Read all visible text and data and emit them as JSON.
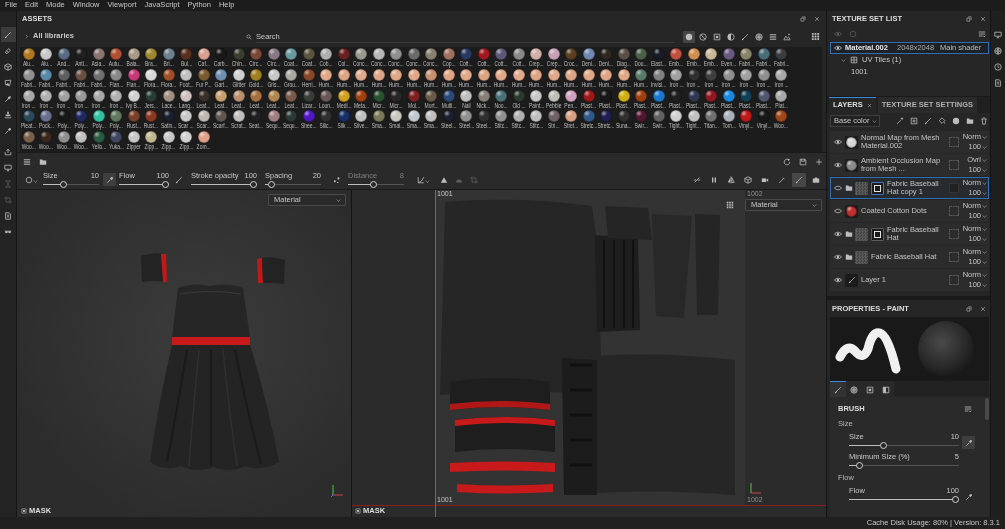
{
  "menu": [
    "File",
    "Edit",
    "Mode",
    "Window",
    "Viewport",
    "JavaScript",
    "Python",
    "Help"
  ],
  "tool_strip": {
    "tools": [
      {
        "selected": true
      },
      {
        "selected": false
      },
      {
        "selected": false
      },
      {
        "selected": false
      },
      {
        "selected": false
      },
      {
        "selected": false
      },
      {
        "selected": false
      }
    ],
    "actions": [
      {
        "disabled": false
      },
      {
        "disabled": false
      },
      {
        "disabled": true
      },
      {
        "disabled": true
      },
      {
        "disabled": false
      },
      {
        "disabled": false
      }
    ]
  },
  "assets": {
    "title": "ASSETS",
    "library": "All libraries",
    "search": {
      "placeholder": "Search"
    },
    "filters": [
      {
        "selected": true
      },
      {
        "selected": false
      },
      {
        "selected": false
      },
      {
        "selected": false
      },
      {
        "selected": false
      },
      {
        "selected": false
      },
      {
        "selected": false
      },
      {
        "selected": false
      }
    ],
    "items": [
      {
        "label": "Alu...",
        "color": "#b07820"
      },
      {
        "label": "Alu...",
        "color": "#c8c8c8"
      },
      {
        "label": "And...",
        "color": "#5a6a80"
      },
      {
        "label": "Antl...",
        "color": "#202020"
      },
      {
        "label": "Asia...",
        "color": "#8a7570"
      },
      {
        "label": "Autu...",
        "color": "#b05030"
      },
      {
        "label": "Bala...",
        "color": "#a89a88"
      },
      {
        "label": "Bra...",
        "color": "#a08830"
      },
      {
        "label": "Bri...",
        "color": "#708090"
      },
      {
        "label": "Bul...",
        "color": "#5a3020"
      },
      {
        "label": "Caf...",
        "color": "#d8a090"
      },
      {
        "label": "Carb...",
        "color": "#181818"
      },
      {
        "label": "Chin...",
        "color": "#3a4030"
      },
      {
        "label": "Circ...",
        "color": "#7a4838"
      },
      {
        "label": "Circ...",
        "color": "#8a7888"
      },
      {
        "label": "Coat...",
        "color": "#6a9aa0"
      },
      {
        "label": "Coat...",
        "color": "#5a5440"
      },
      {
        "label": "Cob...",
        "color": "#b0b0b0"
      },
      {
        "label": "Col...",
        "color": "#6a2020"
      },
      {
        "label": "Conc...",
        "color": "#9a9890"
      },
      {
        "label": "Conc...",
        "color": "#b8b8b8"
      },
      {
        "label": "Conc...",
        "color": "#909090"
      },
      {
        "label": "Conc...",
        "color": "#6a6a6a"
      },
      {
        "label": "Conc...",
        "color": "#8a8070"
      },
      {
        "label": "Cop...",
        "color": "#a07060"
      },
      {
        "label": "Cott...",
        "color": "#283860"
      },
      {
        "label": "Cott...",
        "color": "#a01820"
      },
      {
        "label": "Cott...",
        "color": "#605878"
      },
      {
        "label": "Cott...",
        "color": "#8a8a8a"
      },
      {
        "label": "Crep...",
        "color": "#d0b0a8"
      },
      {
        "label": "Crep...",
        "color": "#c8a0b8"
      },
      {
        "label": "Croc...",
        "color": "#5a4020"
      },
      {
        "label": "Deni...",
        "color": "#7088b0"
      },
      {
        "label": "Deni...",
        "color": "#302820"
      },
      {
        "label": "Diag...",
        "color": "#5a5048"
      },
      {
        "label": "Dou...",
        "color": "#4a6048"
      },
      {
        "label": "Elast...",
        "color": "#181c28"
      },
      {
        "label": "Emb...",
        "color": "#c05040"
      },
      {
        "label": "Emb...",
        "color": "#d09050"
      },
      {
        "label": "Emb...",
        "color": "#c8b898"
      },
      {
        "label": "Even...",
        "color": "#6a5880"
      },
      {
        "label": "Fabri...",
        "color": "#8a8468"
      },
      {
        "label": "Fabri...",
        "color": "#4a6a78"
      },
      {
        "label": "Fabri...",
        "color": "#3a3c40"
      },
      {
        "label": "Fabri...",
        "color": "#909090"
      },
      {
        "label": "Fabri...",
        "color": "#5a88a8"
      },
      {
        "label": "Fabri...",
        "color": "#606060"
      },
      {
        "label": "Fabri...",
        "color": "#6a5040"
      },
      {
        "label": "Fabri...",
        "color": "#707070"
      },
      {
        "label": "Flan...",
        "color": "#888888"
      },
      {
        "label": "Flan...",
        "color": "#c83878"
      },
      {
        "label": "Flora...",
        "color": "#d8d8d8"
      },
      {
        "label": "Flora...",
        "color": "#a05028"
      },
      {
        "label": "Foot...",
        "color": "#c0c0c0"
      },
      {
        "label": "Fur P...",
        "color": "#7a5a30"
      },
      {
        "label": "Gart...",
        "color": "#7090b0"
      },
      {
        "label": "Glitter",
        "color": "#d0d0d0"
      },
      {
        "label": "Gold...",
        "color": "#a08020"
      },
      {
        "label": "Gris...",
        "color": "#c8c8c8"
      },
      {
        "label": "Grou...",
        "color": "#a8a8a0"
      },
      {
        "label": "Herri...",
        "color": "#8a4828"
      },
      {
        "label": "Hum...",
        "color": "#e0a888"
      },
      {
        "label": "Hum...",
        "color": "#dca482"
      },
      {
        "label": "Hum...",
        "color": "#e2aa8c"
      },
      {
        "label": "Hum...",
        "color": "#dea686"
      },
      {
        "label": "Hum...",
        "color": "#e0a888"
      },
      {
        "label": "Hum...",
        "color": "#e0a888"
      },
      {
        "label": "Hum...",
        "color": "#c89070"
      },
      {
        "label": "Hum...",
        "color": "#dea686"
      },
      {
        "label": "Hum...",
        "color": "#e0a888"
      },
      {
        "label": "Hum...",
        "color": "#dca482"
      },
      {
        "label": "Hum...",
        "color": "#e0a888"
      },
      {
        "label": "Hum...",
        "color": "#e2aa8c"
      },
      {
        "label": "Hum...",
        "color": "#dea686"
      },
      {
        "label": "Hum...",
        "color": "#e0a888"
      },
      {
        "label": "Hum...",
        "color": "#dca482"
      },
      {
        "label": "Hum...",
        "color": "#e0a888"
      },
      {
        "label": "Hum...",
        "color": "#dea686"
      },
      {
        "label": "Hum...",
        "color": "#e0a888"
      },
      {
        "label": "Hum...",
        "color": "#5a7a68"
      },
      {
        "label": "Invisi...",
        "color": "#808080"
      },
      {
        "label": "Iron ...",
        "color": "#a0a0a0"
      },
      {
        "label": "Iron ...",
        "color": "#303030"
      },
      {
        "label": "Iron ...",
        "color": "#404040"
      },
      {
        "label": "Iron ...",
        "color": "#909090"
      },
      {
        "label": "Iron ...",
        "color": "#a0a0a0"
      },
      {
        "label": "Iron ...",
        "color": "#909090"
      },
      {
        "label": "Iron ...",
        "color": "#a8a8a8"
      },
      {
        "label": "Iron ...",
        "color": "#a8a8a8"
      },
      {
        "label": "Iron ...",
        "color": "#b0b0b0"
      },
      {
        "label": "Iron ...",
        "color": "#a0a0a0"
      },
      {
        "label": "Iron ...",
        "color": "#989898"
      },
      {
        "label": "Iron ...",
        "color": "#a8a8a8"
      },
      {
        "label": "Iron ...",
        "color": "#b0b0b0"
      },
      {
        "label": "Ivy B...",
        "color": "#d0d0d0"
      },
      {
        "label": "Jers...",
        "color": "#2a3c38"
      },
      {
        "label": "Lace...",
        "color": "#a09080"
      },
      {
        "label": "Lang...",
        "color": "#d0c0c0"
      },
      {
        "label": "Leat...",
        "color": "#3a3028"
      },
      {
        "label": "Leat...",
        "color": "#c8a070"
      },
      {
        "label": "Leat...",
        "color": "#b89070"
      },
      {
        "label": "Leat...",
        "color": "#a87040"
      },
      {
        "label": "Leat...",
        "color": "#b08850"
      },
      {
        "label": "Leat...",
        "color": "#7a5a48"
      },
      {
        "label": "Lizar...",
        "color": "#3a3e38"
      },
      {
        "label": "Loun...",
        "color": "#6a5858"
      },
      {
        "label": "Medi...",
        "color": "#d0a020"
      },
      {
        "label": "Meta...",
        "color": "#a04010"
      },
      {
        "label": "Micr...",
        "color": "#2a5030"
      },
      {
        "label": "Micr...",
        "color": "#282828"
      },
      {
        "label": "Mol...",
        "color": "#802020"
      },
      {
        "label": "Mort...",
        "color": "#6a5a48"
      },
      {
        "label": "Multi...",
        "color": "#2a4878"
      },
      {
        "label": "Nail",
        "color": "#c0c0c0"
      },
      {
        "label": "Nick...",
        "color": "#888078"
      },
      {
        "label": "Noo...",
        "color": "#4a7078"
      },
      {
        "label": "Old ...",
        "color": "#2a3a30"
      },
      {
        "label": "Paint...",
        "color": "#c8c8c8"
      },
      {
        "label": "Pebble",
        "color": "#c0c0b8"
      },
      {
        "label": "Pen...",
        "color": "#d0a0c0"
      },
      {
        "label": "Plast...",
        "color": "#a01818"
      },
      {
        "label": "Plast...",
        "color": "#181818"
      },
      {
        "label": "Plast...",
        "color": "#d0b010"
      },
      {
        "label": "Plast...",
        "color": "#a04010"
      },
      {
        "label": "Plast...",
        "color": "#1878d0"
      },
      {
        "label": "Plast...",
        "color": "#202020"
      },
      {
        "label": "Plast...",
        "color": "#303850"
      },
      {
        "label": "Plast...",
        "color": "#901820"
      },
      {
        "label": "Plast...",
        "color": "#1888e0"
      },
      {
        "label": "Plast...",
        "color": "#104058"
      },
      {
        "label": "Plast...",
        "color": "#505870"
      },
      {
        "label": "Plat...",
        "color": "#a8a8a8"
      },
      {
        "label": "Pleat...",
        "color": "#2a4858"
      },
      {
        "label": "Pock...",
        "color": "#6a7090"
      },
      {
        "label": "Poly...",
        "color": "#181818"
      },
      {
        "label": "Poly...",
        "color": "#202a60"
      },
      {
        "label": "Poly...",
        "color": "#30c0a0"
      },
      {
        "label": "Poly...",
        "color": "#607860"
      },
      {
        "label": "Rust...",
        "color": "#7a4028"
      },
      {
        "label": "Rust...",
        "color": "#8a3820"
      },
      {
        "label": "Satin...",
        "color": "#1a2030"
      },
      {
        "label": "Scar ...",
        "color": "#c8c8c8"
      },
      {
        "label": "Scar...",
        "color": "#c0b8b0"
      },
      {
        "label": "Scarf...",
        "color": "#605850"
      },
      {
        "label": "Scrat...",
        "color": "#c0c0c0"
      },
      {
        "label": "Seat...",
        "color": "#202020"
      },
      {
        "label": "Sequ...",
        "color": "#a08080"
      },
      {
        "label": "Sequ...",
        "color": "#2a3838"
      },
      {
        "label": "Shee...",
        "color": "#5018c0"
      },
      {
        "label": "Silic...",
        "color": "#303030"
      },
      {
        "label": "Silk ...",
        "color": "#183068"
      },
      {
        "label": "Silve...",
        "color": "#c0c0c0"
      },
      {
        "label": "Sma...",
        "color": "#7a7858"
      },
      {
        "label": "Smal...",
        "color": "#c8c8c0"
      },
      {
        "label": "Sma...",
        "color": "#c0c8d0"
      },
      {
        "label": "Sma...",
        "color": "#c0c0c0"
      },
      {
        "label": "Steel...",
        "color": "#1a2030"
      },
      {
        "label": "Steel...",
        "color": "#909090"
      },
      {
        "label": "Steel...",
        "color": "#303030"
      },
      {
        "label": "Stitc...",
        "color": "#909090"
      },
      {
        "label": "Stitc...",
        "color": "#b0b0b0"
      },
      {
        "label": "Stitc...",
        "color": "#c0c0c0"
      },
      {
        "label": "Stri...",
        "color": "#706068"
      },
      {
        "label": "Stret...",
        "color": "#d8a080"
      },
      {
        "label": "Stretc...",
        "color": "#305888"
      },
      {
        "label": "Stretc...",
        "color": "#202050"
      },
      {
        "label": "Suna...",
        "color": "#303030"
      },
      {
        "label": "Swir...",
        "color": "#501830"
      },
      {
        "label": "Swir...",
        "color": "#606060"
      },
      {
        "label": "Tight...",
        "color": "#d0d0d0"
      },
      {
        "label": "Tight...",
        "color": "#c0c0c0"
      },
      {
        "label": "Titan...",
        "color": "#707070"
      },
      {
        "label": "Tom...",
        "color": "#a8b0b8"
      },
      {
        "label": "Vinyl...",
        "color": "#c01818"
      },
      {
        "label": "Vinyl...",
        "color": "#181818"
      },
      {
        "label": "Woo...",
        "color": "#a04818"
      },
      {
        "label": "Woo...",
        "color": "#7a6048"
      },
      {
        "label": "Woo...",
        "color": "#3a2820"
      },
      {
        "label": "Woo...",
        "color": "#909090"
      },
      {
        "label": "Woo...",
        "color": "#c0c0c0"
      },
      {
        "label": "Yello...",
        "color": "#2a5a40"
      },
      {
        "label": "Yuka...",
        "color": "#404860"
      },
      {
        "label": "Zipper",
        "color": "#c8c8c8"
      },
      {
        "label": "Zipp...",
        "color": "#c0b890"
      },
      {
        "label": "Zipp...",
        "color": "#c8c8c8"
      },
      {
        "label": "Zipp...",
        "color": "#d0d0d0"
      },
      {
        "label": "Zom...",
        "color": "#e0a088"
      }
    ]
  },
  "tool_settings": {
    "sliders": [
      {
        "label": "Size",
        "value": "10",
        "level": 0.34,
        "disabled": false
      },
      {
        "label": "Flow",
        "value": "100",
        "level": 1,
        "disabled": false
      },
      {
        "label": "Stroke opacity",
        "value": "100",
        "level": 1,
        "disabled": false
      },
      {
        "label": "Spacing",
        "value": "20",
        "level": 0.06,
        "disabled": false
      },
      {
        "label": "Distance",
        "value": "8",
        "level": 0.45,
        "disabled": true
      }
    ]
  },
  "view_tools": [
    {
      "selected": false
    },
    {
      "selected": false
    },
    {
      "selected": false
    },
    {
      "selected": false
    },
    {
      "selected": false
    },
    {
      "selected": false
    },
    {
      "selected": true
    },
    {
      "selected": false
    }
  ],
  "viewports": {
    "model": {
      "display": "Material",
      "mask": "MASK"
    },
    "uv": {
      "display": "Material",
      "mask": "MASK",
      "tiles_top": [
        {
          "name": "1001",
          "active": true
        },
        {
          "name": "1002",
          "active": false
        }
      ],
      "tiles_bottom": [
        {
          "name": "1001",
          "active": true
        },
        {
          "name": "1002",
          "active": false
        }
      ]
    }
  },
  "texture_set_list": {
    "title": "TEXTURE SET LIST",
    "sets": [
      {
        "name": "Material.002",
        "resolution": "2048x2048",
        "shader": "Main shader",
        "selected": true,
        "uv_tiles": {
          "label": "UV Tiles (1)",
          "expanded": true,
          "tiles": [
            "1001"
          ]
        }
      }
    ]
  },
  "layers": {
    "tabs": [
      {
        "label": "LAYERS",
        "selected": true,
        "closable": true
      },
      {
        "label": "TEXTURE SET SETTINGS",
        "selected": false,
        "closable": false
      }
    ],
    "channel": "Base color",
    "items": [
      {
        "name": "Normal Map from Mesh Material.002",
        "kind": "fill",
        "color": "#d8d8d8",
        "visible": true,
        "selected": false,
        "mask": false,
        "blend": "Norm",
        "opacity": "100"
      },
      {
        "name": "Ambient Occlusion Map from Mesh ...",
        "kind": "fill",
        "color": "#8c8c8c",
        "visible": true,
        "selected": false,
        "mask": false,
        "blend": "Ovrl",
        "opacity": "100"
      },
      {
        "name": "Fabric Baseball Hat copy 1",
        "kind": "folder",
        "visible": false,
        "selected": true,
        "mask": true,
        "blend": "Norm",
        "opacity": "100"
      },
      {
        "name": "Coated Cotton Dots",
        "kind": "fill",
        "color": "#c03030",
        "visible": false,
        "selected": false,
        "mask": false,
        "blend": "Norm",
        "opacity": "100"
      },
      {
        "name": "Fabric Baseball Hat",
        "kind": "folder",
        "visible": true,
        "selected": false,
        "mask": true,
        "blend": "Norm",
        "opacity": "100"
      },
      {
        "name": "Fabric Baseball Hat",
        "kind": "folder",
        "visible": true,
        "selected": false,
        "mask": false,
        "blend": "Norm",
        "opacity": "100"
      },
      {
        "name": "Layer 1",
        "kind": "paint",
        "visible": true,
        "selected": false,
        "mask": false,
        "blend": "Norm",
        "opacity": "100"
      }
    ]
  },
  "properties": {
    "title": "PROPERTIES - PAINT",
    "tabs": [
      {
        "selected": true
      },
      {
        "selected": false
      },
      {
        "selected": false
      },
      {
        "selected": false
      }
    ],
    "section": "BRUSH",
    "groups": [
      {
        "label": "Size",
        "sliders": [
          {
            "label": "Size",
            "value": "10",
            "level": 0.3,
            "kind": "button"
          },
          {
            "label": "Minimum Size (%)",
            "value": "5",
            "level": 0.07,
            "kind": "plain"
          }
        ]
      },
      {
        "label": "Flow",
        "sliders": [
          {
            "label": "Flow",
            "value": "100",
            "level": 1,
            "kind": "icon"
          }
        ]
      }
    ]
  },
  "status_bar": "Cache Disk Usage: 80% | Version: 8.3.1"
}
